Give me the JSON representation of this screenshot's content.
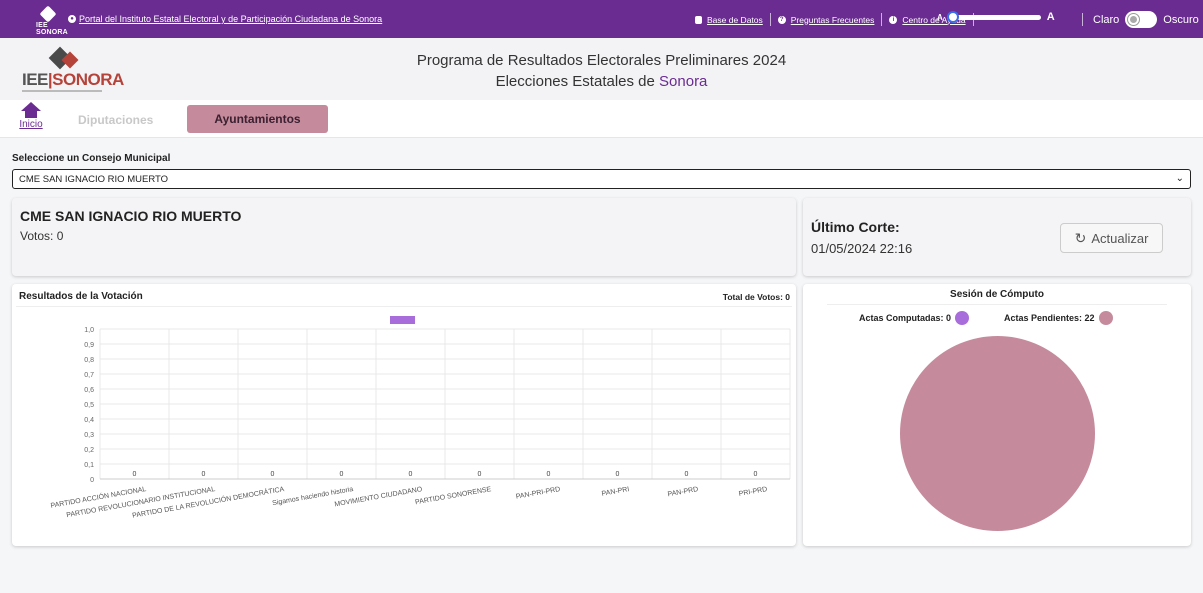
{
  "topbar": {
    "logo_text": "IEE SONORA",
    "portal_link": "Portal del Instituto Estatal Electoral y de Participación Ciudadana de Sonora",
    "links": [
      "Base de Datos",
      "Preguntas Frecuentes",
      "Centro de Ayuda"
    ],
    "font_small": "A",
    "font_large": "A",
    "font_size_level": 0.0,
    "theme_light": "Claro",
    "theme_dark": "Oscuro"
  },
  "header": {
    "logo_left": "IEE",
    "logo_right": "SONORA",
    "title_line1": "Programa de Resultados Electorales Preliminares 2024",
    "title_line2_prefix": "Elecciones Estatales de ",
    "title_line2_accent": "Sonora"
  },
  "nav": {
    "home_label": "Inicio",
    "tab_diputaciones": "Diputaciones",
    "tab_ayuntamientos": "Ayuntamientos"
  },
  "selector": {
    "label": "Seleccione un Consejo Municipal",
    "value": "CME SAN IGNACIO RIO MUERTO"
  },
  "municipio": {
    "name": "CME SAN IGNACIO RIO MUERTO",
    "votes": "Votos: 0"
  },
  "corte": {
    "label": "Último Corte:",
    "value": "01/05/2024 22:16",
    "refresh_button": "Actualizar"
  },
  "results": {
    "title": "Resultados de la Votación",
    "total": "Total de Votos: 0"
  },
  "computo": {
    "title": "Sesión de Cómputo",
    "computadas_label": "Actas Computadas: 0",
    "pendientes_label": "Actas Pendientes: 22",
    "computadas": 0,
    "pendientes": 22,
    "color_computadas": "#a86ddb",
    "color_pendientes": "#c58b9c"
  },
  "chart_data": {
    "type": "bar",
    "categories": [
      "PARTIDO ACCIÓN NACIONAL",
      "PARTIDO REVOLUCIONARIO INSTITUCIONAL",
      "PARTIDO DE LA REVOLUCIÓN DEMOCRÁTICA",
      "Sigamos haciendo historia",
      "MOVIMIENTO CIUDADANO",
      "PARTIDO SONORENSE",
      "PAN-PRI-PRD",
      "PAN-PRI",
      "PAN-PRD",
      "PRI-PRD"
    ],
    "values": [
      0,
      0,
      0,
      0,
      0,
      0,
      0,
      0,
      0,
      0
    ],
    "yticks": [
      "0",
      "0,1",
      "0,2",
      "0,3",
      "0,4",
      "0,5",
      "0,6",
      "0,7",
      "0,8",
      "0,9",
      "1,0"
    ],
    "ylim": [
      0,
      1
    ],
    "legend_color": "#a86ddb",
    "grid": true
  }
}
